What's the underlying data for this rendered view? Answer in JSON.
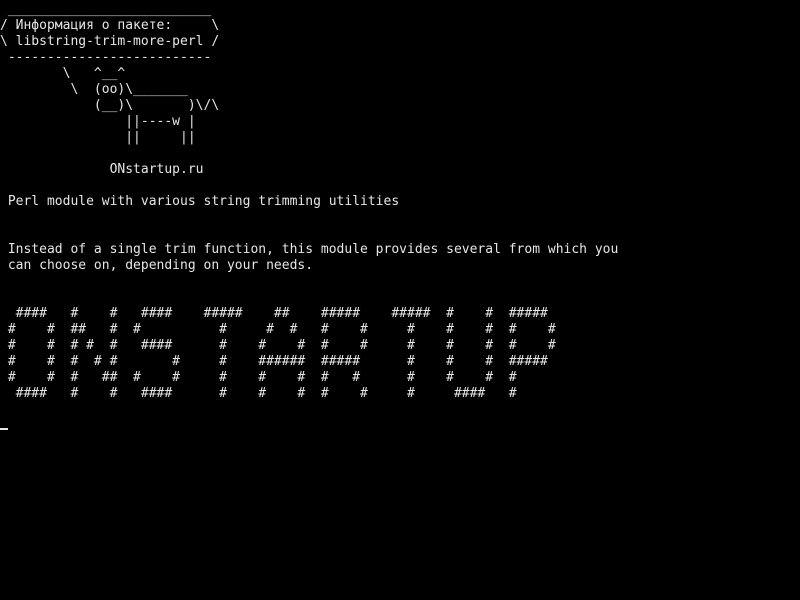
{
  "terminal": {
    "colors": {
      "background": "#000000",
      "foreground": "#e6e6e6"
    },
    "cowsay": {
      "bubble_top": " __________________________",
      "bubble_line1": "/ Информация о пакете:     \\",
      "bubble_line2": "\\ libstring-trim-more-perl /",
      "bubble_bottom": " --------------------------",
      "cow_line1": "        \\   ^__^",
      "cow_line2": "         \\  (oo)\\_______",
      "cow_line3": "            (__)\\       )\\/\\",
      "cow_line4": "                ||----w |",
      "cow_line5": "                ||     ||",
      "site": "              ONstartup.ru"
    },
    "description": {
      "summary": " Perl module with various string trimming utilities",
      "body_line1": " Instead of a single trim function, this module provides several from which you",
      "body_line2": " can choose on, depending on your needs."
    },
    "banner": {
      "row1": "  ####   #    #   ####    #####    ##    #####    #####  #    #  #####",
      "row2": " #    #  ##   #  #          #     #  #   #    #     #    #    #  #    #",
      "row3": " #    #  # #  #   ####      #    #    #  #    #     #    #    #  #    #",
      "row4": " #    #  #  # #       #     #    ######  #####      #    #    #  #####",
      "row5": " #    #  #   ##  #    #     #    #    #  #   #      #    #    #  #",
      "row6": "  ####   #    #   ####      #    #    #  #    #     #     ####   #"
    }
  }
}
